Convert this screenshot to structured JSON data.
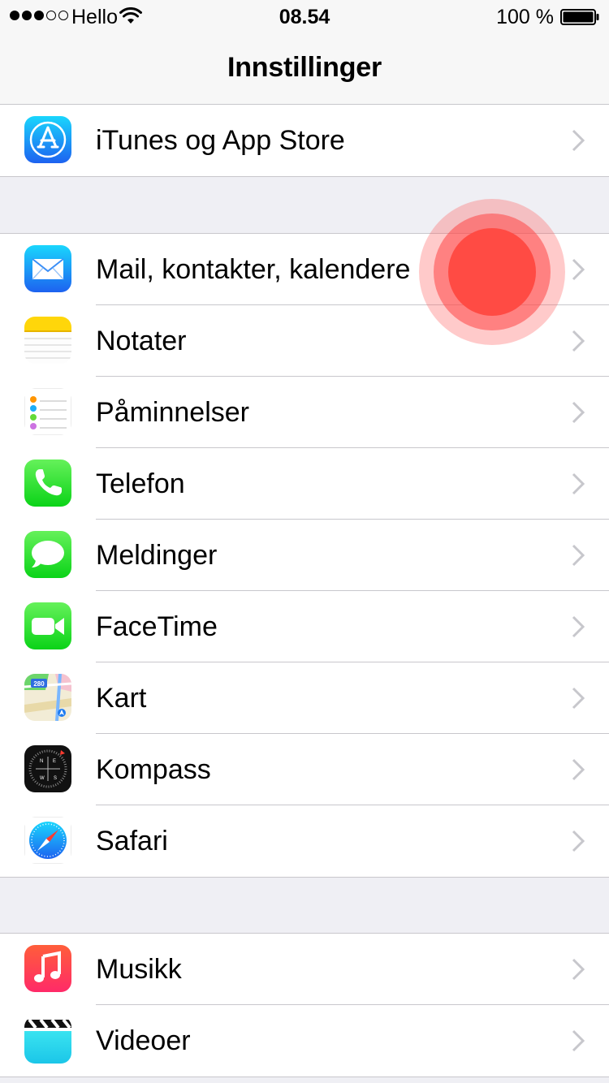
{
  "status_bar": {
    "signal_dots_filled": 3,
    "signal_dots_total": 5,
    "carrier": "Hello",
    "time": "08.54",
    "battery_percent": "100 %"
  },
  "nav": {
    "title": "Innstillinger"
  },
  "groups": [
    {
      "rows": [
        {
          "label": "iTunes og App Store",
          "icon": "app-store-icon"
        }
      ]
    },
    {
      "rows": [
        {
          "label": "Mail, kontakter, kalendere",
          "icon": "mail-icon"
        },
        {
          "label": "Notater",
          "icon": "notes-icon"
        },
        {
          "label": "Påminnelser",
          "icon": "reminders-icon"
        },
        {
          "label": "Telefon",
          "icon": "phone-icon"
        },
        {
          "label": "Meldinger",
          "icon": "messages-icon"
        },
        {
          "label": "FaceTime",
          "icon": "facetime-icon"
        },
        {
          "label": "Kart",
          "icon": "maps-icon"
        },
        {
          "label": "Kompass",
          "icon": "compass-icon"
        },
        {
          "label": "Safari",
          "icon": "safari-icon"
        }
      ]
    },
    {
      "rows": [
        {
          "label": "Musikk",
          "icon": "music-icon"
        },
        {
          "label": "Videoer",
          "icon": "videos-icon"
        }
      ]
    }
  ],
  "colors": {
    "background": "#efeff4",
    "separator": "#c8c7cc",
    "chevron": "#c7c7cc",
    "touch_indicator": "#ff4b44"
  }
}
